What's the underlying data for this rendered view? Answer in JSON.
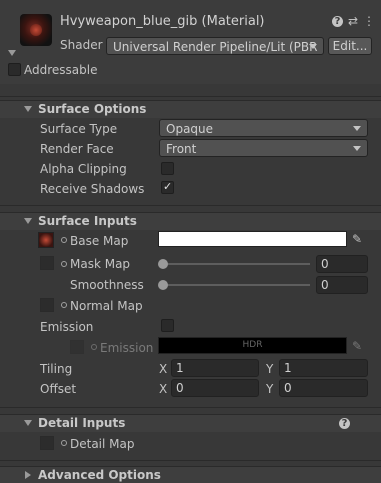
{
  "header": {
    "title": "Hvyweapon_blue_gib (Material)",
    "shader_label": "Shader",
    "shader_value": "Universal Render Pipeline/Lit (PBR",
    "edit_label": "Edit...",
    "addressable_label": "Addressable",
    "icons": [
      "help-icon",
      "settings-sliders-icon",
      "more-vert-icon"
    ]
  },
  "surface_options": {
    "title": "Surface Options",
    "surface_type": {
      "label": "Surface Type",
      "value": "Opaque"
    },
    "render_face": {
      "label": "Render Face",
      "value": "Front"
    },
    "alpha_clipping": {
      "label": "Alpha Clipping",
      "checked": false
    },
    "receive_shadows": {
      "label": "Receive Shadows",
      "checked": true
    }
  },
  "surface_inputs": {
    "title": "Surface Inputs",
    "base_map": {
      "label": "Base Map",
      "color": "#ffffff"
    },
    "mask_map": {
      "label": "Mask Map",
      "value": "0",
      "slider": 0
    },
    "smoothness": {
      "label": "Smoothness",
      "value": "0",
      "slider": 0
    },
    "normal_map": {
      "label": "Normal Map"
    },
    "emission": {
      "label": "Emission",
      "checked": false
    },
    "emission_map": {
      "label": "Emission M",
      "badge": "HDR",
      "color": "#000000"
    },
    "tiling": {
      "label": "Tiling",
      "x_label": "X",
      "x": "1",
      "y_label": "Y",
      "y": "1"
    },
    "offset": {
      "label": "Offset",
      "x_label": "X",
      "x": "0",
      "y_label": "Y",
      "y": "0"
    }
  },
  "detail_inputs": {
    "title": "Detail Inputs",
    "detail_map": {
      "label": "Detail Map"
    }
  },
  "advanced_options": {
    "title": "Advanced Options"
  }
}
